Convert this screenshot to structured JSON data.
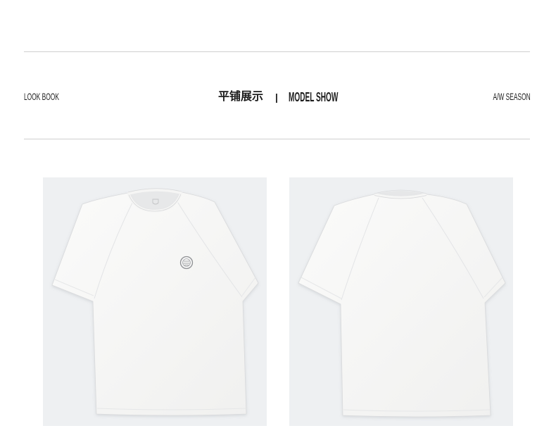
{
  "header": {
    "left_label": "LOOK BOOK",
    "center_cn": "平铺展示",
    "separator": "|",
    "center_en": "MODEL SHOW",
    "right_label": "A/W SEASON"
  },
  "colors": {
    "page_bg": "#ffffff",
    "rule": "#cfcfcf",
    "text": "#1c1c1c",
    "panel_bg": "#eef0f2",
    "shirt": "#f8f8f7"
  },
  "icons": {
    "chest_logo": "chest-logo-badge-icon",
    "neck_logo": "neck-label-logo-icon"
  }
}
